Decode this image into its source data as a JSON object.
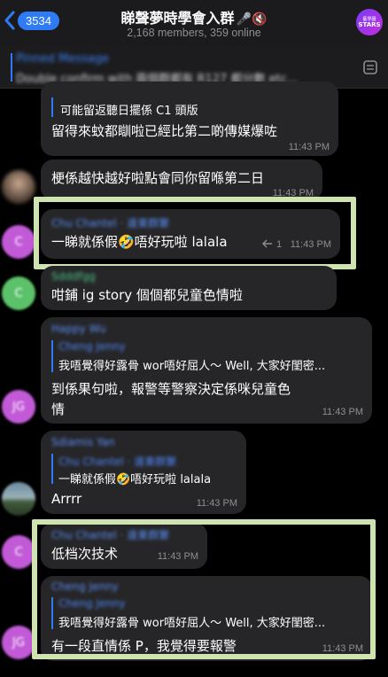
{
  "header": {
    "back_count": "3534",
    "title": "睇聲夢時學會入群",
    "title_icons": "🎤🔇",
    "subtitle": "2,168 members, 359 online",
    "group_avatar_text_1": "藝學園",
    "group_avatar_text_2": "STARS"
  },
  "pinned": {
    "title": "Pinned Message",
    "text": "Double confirm with 兩個群都有 R127 都分數 etc..."
  },
  "messages": [
    {
      "quote_text": "可能留返聽日擺係 C1 頭版",
      "text": "留得來蚊都瞓啦已經比第二啲傳媒爆咗",
      "time": "11:43 PM"
    },
    {
      "text": "梗係越快越好啦點會同你留喺第二日",
      "time": "11:43 PM"
    },
    {
      "sender": "Chu Chantel · 遠東群聚",
      "text": "一睇就係假🤣唔好玩啦 lalala",
      "reply_count": "1",
      "time": "11:43 PM"
    },
    {
      "sender": "Sdddfgg",
      "text": "咁鋪 ig story 個個都兒童色情啦",
      "time": "11:43 PM"
    },
    {
      "sender": "Happy Wu",
      "quote_name": "Cheng Jenny",
      "quote_text": "我唔覺得好露骨 wor唔好屈人～ Well, 大家好閨密...",
      "text_1": "到係果句啦，報警等警察決定係咪兒童色",
      "text_2": "情",
      "time": "11:43 PM"
    },
    {
      "sender": "Sdiamis Yan",
      "quote_name": "Chu Chantel · 遠東群聚",
      "quote_text": "一睇就係假🤣唔好玩啦 lalala",
      "text": "Arrrr",
      "time": "11:43 PM"
    },
    {
      "sender": "Chu Chantel · 遠東群聚",
      "text": "低档次技术",
      "time": "11:43 PM"
    },
    {
      "sender": "Cheng Jenny",
      "quote_name": "Cheng Jenny",
      "quote_text": "我唔覺得好露骨 wor唔好屈人～ Well, 大家好閨密...",
      "text": "有一段直情係 P，我覺得要報警",
      "time": "11:43 PM"
    }
  ],
  "avatars": [
    "C",
    "C",
    "C",
    "JG",
    "C",
    "JG"
  ],
  "colors": {
    "accent": "#2f7bf5",
    "bubble": "#262628",
    "highlight": "#cfe3b0"
  }
}
